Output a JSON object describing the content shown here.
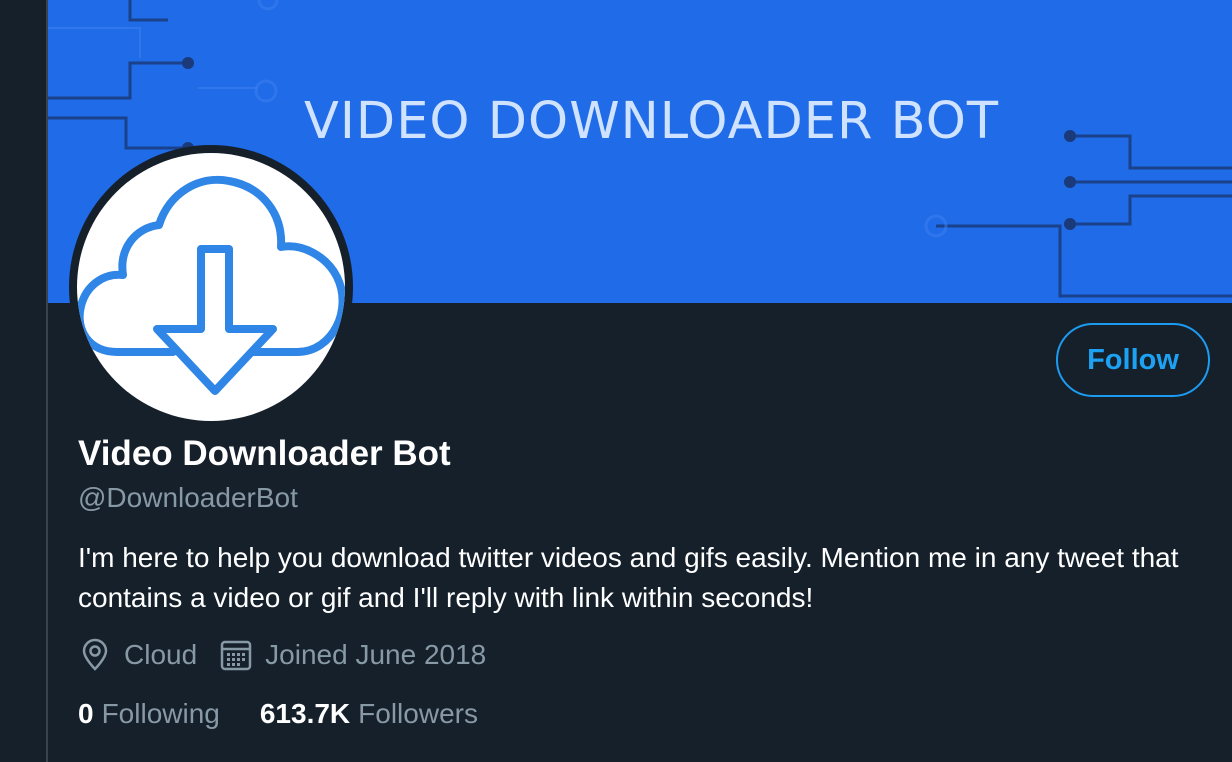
{
  "banner": {
    "title": "VIDEO DOWNLOADER BOT",
    "background_color": "#1f6be8"
  },
  "avatar": {
    "icon": "cloud-download-icon",
    "icon_color": "#2f86e6"
  },
  "profile": {
    "display_name": "Video Downloader Bot",
    "handle": "@DownloaderBot",
    "bio": "I'm here to help you download twitter videos and gifs easily. Mention me in any tweet that contains a video or gif and I'll reply with link within seconds!",
    "location": "Cloud",
    "location_icon": "location-pin-icon",
    "joined": "Joined June 2018",
    "joined_icon": "calendar-icon"
  },
  "actions": {
    "follow_label": "Follow",
    "accent_color": "#1da1f2"
  },
  "stats": {
    "following_count": "0",
    "following_label": "Following",
    "followers_count": "613.7K",
    "followers_label": "Followers"
  },
  "theme": {
    "background": "#15202b",
    "secondary_text": "#8899a6"
  }
}
